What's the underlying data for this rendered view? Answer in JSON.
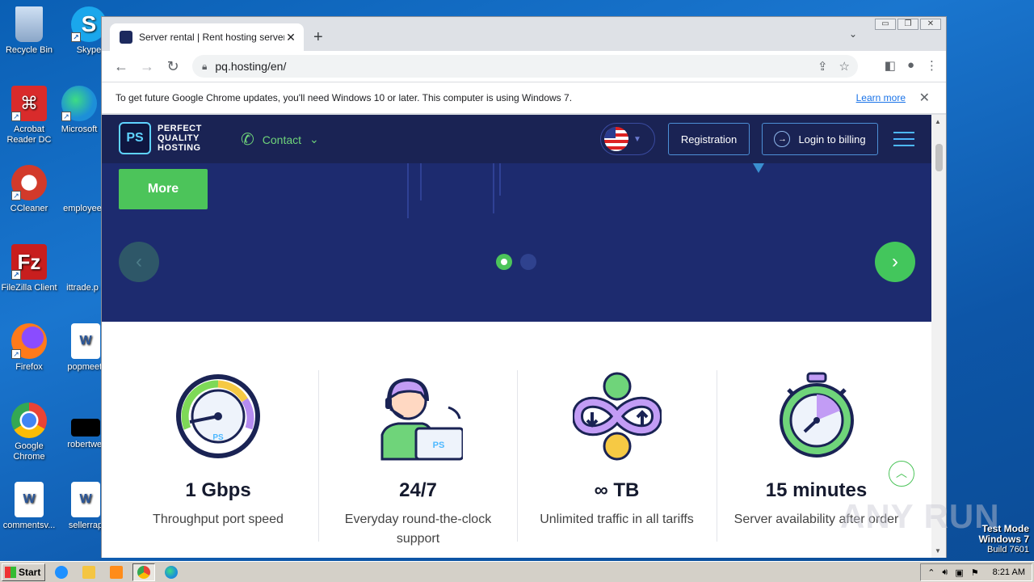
{
  "desktop": {
    "icons": [
      {
        "label": "Recycle Bin",
        "color": "#9fb8d8"
      },
      {
        "label": "Skype",
        "color": "#1aa7ec"
      },
      {
        "label": "Acrobat\nReader DC",
        "color": "#d92b2b"
      },
      {
        "label": "Microsoft",
        "color": "#1d8fd8"
      },
      {
        "label": "CCleaner",
        "color": "#d23a2a"
      },
      {
        "label": "employee",
        "color": "#2a6fc0"
      },
      {
        "label": "FileZilla Client",
        "color": "#c81e1e"
      },
      {
        "label": "ittrade.p",
        "color": "#2a6fc0"
      },
      {
        "label": "Firefox",
        "color": "#ff7a1a"
      },
      {
        "label": "popmeeti",
        "color": "#ffffff"
      },
      {
        "label": "Google\nChrome",
        "color": "#34a853"
      },
      {
        "label": "robertwel",
        "color": "#000000"
      },
      {
        "label": "commentsv...",
        "color": "#ffffff"
      },
      {
        "label": "sellerrap",
        "color": "#ffffff"
      }
    ]
  },
  "browser": {
    "tab_title": "Server rental | Rent hosting servers",
    "tab_close": "✕",
    "new_tab": "+",
    "tab_menu": "⌄",
    "window_controls": [
      "▭",
      "❐",
      "✕"
    ],
    "url": "pq.hosting/en/",
    "infobar": {
      "message": "To get future Google Chrome updates, you'll need Windows 10 or later. This computer is using Windows 7.",
      "link": "Learn more",
      "close": "✕"
    }
  },
  "site": {
    "logo_mark": "PS",
    "logo_text": "PERFECT\nQUALITY\nHOSTING",
    "contact": "Contact",
    "registration": "Registration",
    "login": "Login to billing",
    "hero": {
      "more_button": "More",
      "prev": "‹",
      "next": "›",
      "slides": 2,
      "active_slide": 1
    },
    "features": [
      {
        "value": "1 Gbps",
        "desc": "Throughput port speed",
        "icon": "speedometer-icon"
      },
      {
        "value": "24/7",
        "desc": "Everyday round-the-clock support",
        "icon": "support-agent-icon"
      },
      {
        "value": "∞ TB",
        "desc": "Unlimited traffic in all tariffs",
        "icon": "infinity-traffic-icon"
      },
      {
        "value": "15 minutes",
        "desc": "Server availability after order",
        "icon": "stopwatch-icon"
      }
    ],
    "to_top": "︿"
  },
  "taskbar": {
    "start": "Start",
    "clock": "8:21 AM"
  },
  "watermark": {
    "line1": "Test Mode",
    "line2": "Windows 7",
    "line3": "Build 7601",
    "brand": "ANY RUN"
  },
  "colors": {
    "header_bg": "#1a2354",
    "hero_bg": "#1d2b6f",
    "accent_green": "#4cc45a",
    "accent_blue": "#4db8ff"
  }
}
